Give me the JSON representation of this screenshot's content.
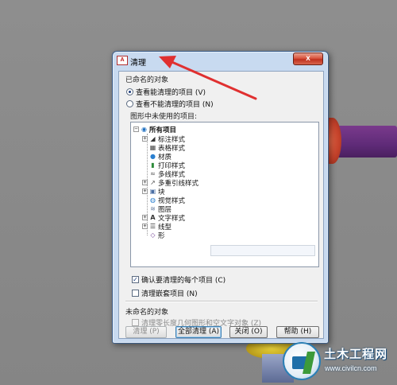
{
  "dialog": {
    "title": "清理",
    "app_icon_text": "A",
    "close_label": "x",
    "named_group_label": "已命名的对象",
    "radio_view_purgeable": "查看能清理的项目 (V)",
    "radio_view_unpurgeable": "查看不能清理的项目 (N)",
    "tree_label": "图形中未使用的项目:",
    "tree": {
      "root": "所有项目",
      "items": [
        {
          "label": "标注样式",
          "icon": "dimension-style-icon",
          "expandable": true
        },
        {
          "label": "表格样式",
          "icon": "table-style-icon",
          "expandable": false
        },
        {
          "label": "材质",
          "icon": "material-icon",
          "expandable": false
        },
        {
          "label": "打印样式",
          "icon": "plot-style-icon",
          "expandable": false
        },
        {
          "label": "多线样式",
          "icon": "multiline-style-icon",
          "expandable": false
        },
        {
          "label": "多重引线样式",
          "icon": "mleader-style-icon",
          "expandable": true
        },
        {
          "label": "块",
          "icon": "block-icon",
          "expandable": true
        },
        {
          "label": "视觉样式",
          "icon": "visual-style-icon",
          "expandable": false
        },
        {
          "label": "图层",
          "icon": "layer-icon",
          "expandable": false
        },
        {
          "label": "文字样式",
          "icon": "text-style-icon",
          "expandable": true
        },
        {
          "label": "线型",
          "icon": "linetype-icon",
          "expandable": true
        },
        {
          "label": "形",
          "icon": "shape-icon",
          "expandable": false
        }
      ]
    },
    "checkbox_confirm": "确认要清理的每个项目 (C)",
    "checkbox_nested": "清理嵌套项目 (N)",
    "unnamed_group_label": "未命名的对象",
    "checkbox_zero_length": "清理零长度几何图形和空文字对象 (Z)",
    "buttons": {
      "purge": "清理 (P)",
      "purge_all": "全部清理 (A)",
      "close": "关闭 (O)",
      "help": "帮助 (H)"
    }
  },
  "watermark": {
    "name": "土木工程网",
    "url": "www.civilcn.com"
  },
  "colors": {
    "annotation_arrow": "#e03030",
    "dialog_frame": "#c8daf0"
  }
}
